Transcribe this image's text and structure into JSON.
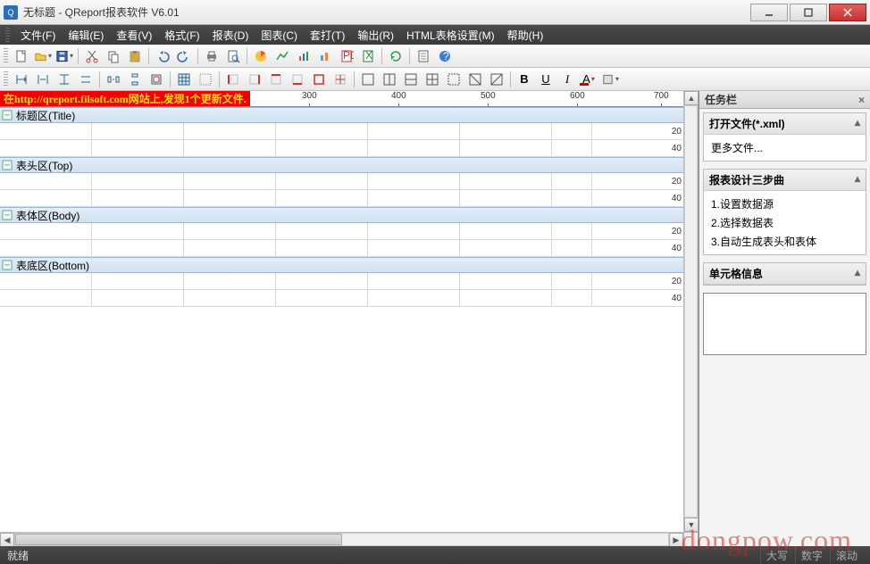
{
  "window": {
    "title": "无标题 - QReport报表软件 V6.01"
  },
  "menu": {
    "file": "文件(F)",
    "edit": "编辑(E)",
    "view": "查看(V)",
    "format": "格式(F)",
    "report": "报表(D)",
    "chart": "图表(C)",
    "batch": "套打(T)",
    "export": "输出(R)",
    "htmltable": "HTML表格设置(M)",
    "help": "帮助(H)"
  },
  "banner": "在http://qreport.filsoft.com网站上,发现1个更新文件.",
  "ruler": {
    "ticks": [
      "300",
      "400",
      "500",
      "600",
      "700"
    ]
  },
  "sections": [
    {
      "name": "标题区(Title)",
      "rows": 2,
      "gauges": [
        "20",
        "40"
      ]
    },
    {
      "name": "表头区(Top)",
      "rows": 2,
      "gauges": [
        "20",
        "40"
      ]
    },
    {
      "name": "表体区(Body)",
      "rows": 2,
      "gauges": [
        "20",
        "40"
      ]
    },
    {
      "name": "表底区(Bottom)",
      "rows": 2,
      "gauges": [
        "20",
        "40"
      ]
    }
  ],
  "side": {
    "title": "任务栏",
    "open": {
      "header": "打开文件(*.xml)",
      "more": "更多文件..."
    },
    "steps": {
      "header": "报表设计三步曲",
      "s1": "1.设置数据源",
      "s2": "2.选择数据表",
      "s3": "3.自动生成表头和表体"
    },
    "cellinfo": "单元格信息"
  },
  "status": {
    "ready": "就绪",
    "caps": "大写",
    "num": "数字",
    "scrl": "滚动"
  },
  "watermark": "dongpow.com"
}
